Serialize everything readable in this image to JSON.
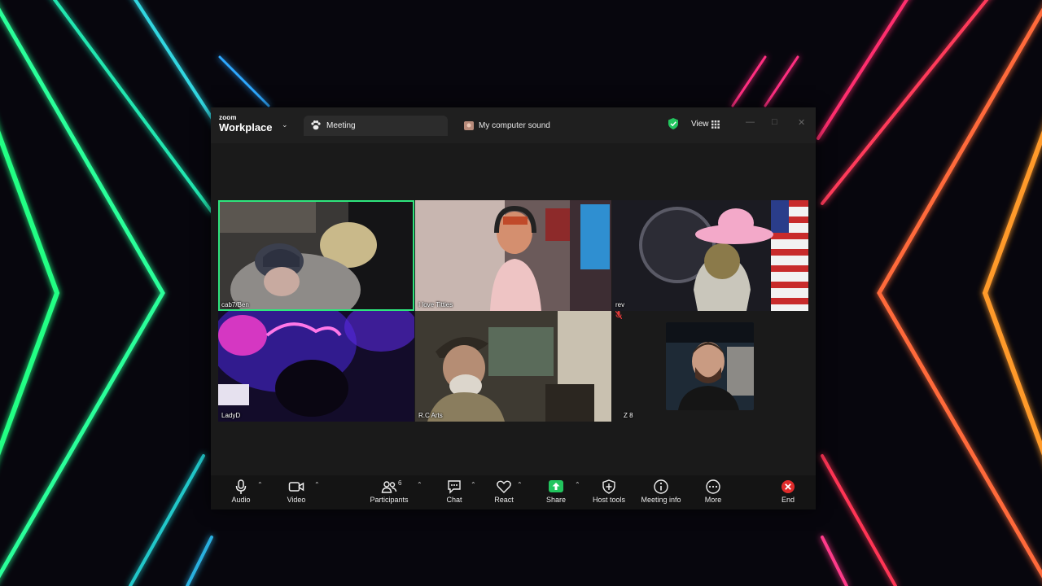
{
  "window": {
    "brand_top": "zoom",
    "brand_bottom": "Workplace",
    "tab_meeting": "Meeting",
    "tab_sound": "My computer sound",
    "view_label": "View"
  },
  "participants": [
    {
      "name": "cab7/Ben",
      "active_speaker": true
    },
    {
      "name": "I love Titties",
      "active_speaker": false
    },
    {
      "name": "rev",
      "active_speaker": false
    },
    {
      "name": "LadyD",
      "active_speaker": false
    },
    {
      "name": "R.C Arts",
      "active_speaker": false
    },
    {
      "name": "Z 8",
      "active_speaker": false,
      "muted": true
    }
  ],
  "toolbar": {
    "audio": "Audio",
    "video": "Video",
    "participants": "Participants",
    "participants_count": "6",
    "chat": "Chat",
    "react": "React",
    "share": "Share",
    "host_tools": "Host tools",
    "meeting_info": "Meeting info",
    "more": "More",
    "end": "End"
  },
  "colors": {
    "active_speaker_border": "#2ee57d",
    "share_button": "#22c55e",
    "end_button": "#e02b2b",
    "shield": "#22c55e"
  }
}
